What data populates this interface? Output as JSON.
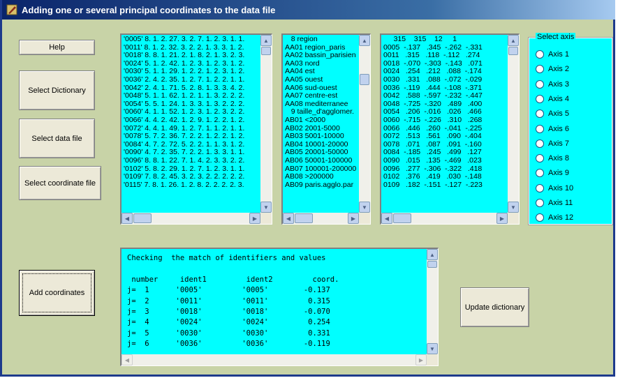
{
  "window": {
    "title": "Adding one or several principal coordinates to the data file"
  },
  "buttons": {
    "help": "Help",
    "select_dictionary": "Select Dictionary",
    "select_data_file": "Select data file",
    "select_coordinate_file": "Select coordinate file",
    "add_coordinates": "Add coordinates",
    "update_dictionary": "Update dictionary"
  },
  "data_list": [
    "'0005' 8. 1. 2. 27. 3. 2. 7. 1. 2. 3. 1. 1.",
    "'0011' 8. 1. 2. 32. 3. 2. 2. 1. 3. 3. 1. 2.",
    "'0018' 8. 8. 1. 21. 2. 1. 8. 2. 1. 3. 2. 3.",
    "'0024' 5. 1. 2. 42. 1. 2. 3. 1. 2. 3. 1. 2.",
    "'0030' 5. 1. 1. 29. 1. 2. 2. 1. 2. 3. 1. 2.",
    "'0036' 2. 4. 2. 35. 1. 2. 7. 1. 2. 2. 1. 1.",
    "'0042' 2. 4. 1. 71. 5. 2. 8. 1. 3. 3. 4. 2.",
    "'0048' 5. 1. 1. 62. 1. 2. 1. 1. 3. 2. 2. 2.",
    "'0054' 5. 5. 1. 24. 1. 3. 3. 1. 3. 2. 2. 2.",
    "'0060' 4. 1. 1. 52. 1. 2. 3. 1. 2. 3. 2. 2.",
    "'0066' 4. 4. 2. 42. 1. 2. 9. 1. 2. 2. 1. 2.",
    "'0072' 4. 4. 1. 49. 1. 2. 7. 1. 1. 2. 1. 1.",
    "'0078' 5. 7. 2. 36. 7. 2. 2. 1. 2. 2. 1. 2.",
    "'0084' 4. 7. 2. 72. 5. 2. 2. 1. 1. 3. 1. 2.",
    "'0090' 4. 7. 2. 35. 7. 2. 2. 1. 3. 3. 1. 1.",
    "'0096' 8. 8. 1. 22. 7. 1. 4. 2. 3. 3. 2. 2.",
    "'0102' 5. 8. 2. 29. 1. 2. 7. 1. 2. 3. 1. 1.",
    "'0109' 7. 8. 2. 45. 3. 2. 3. 2. 2. 2. 2. 2.",
    "'0115' 7. 8. 1. 26. 1. 2. 8. 2. 2. 2. 2. 3."
  ],
  "dictionary_list": [
    "   8 region",
    "AA01 region_paris",
    "AA02 bassin_parisien",
    "AA03 nord",
    "AA04 est",
    "AA05 ouest",
    "AA06 sud-ouest",
    "AA07 centre-est",
    "AA08 mediterranee",
    "   9 taille_d'agglomer.",
    "AB01 <2000",
    "AB02 2001-5000",
    "AB03 5001-10000",
    "AB04 10001-20000",
    "AB05 20001-50000",
    "AB06 50001-100000",
    "AB07 100001-200000",
    "AB08 >200000",
    "AB09 paris.agglo.par"
  ],
  "coordinate_list": [
    "     315    315    12     1",
    "0005  -.137   .345  -.262  -.331",
    "0011   .315   .118  -.112   .274",
    "0018  -.070  -.303  -.143   .071",
    "0024   .254   .212   .088  -.174",
    "0030   .331   .088  -.072  -.029",
    "0036  -.119   .444  -.108  -.371",
    "0042   .588  -.597  -.232  -.447",
    "0048  -.725  -.320   .489   .400",
    "0054   .206  -.016   .026   .466",
    "0060  -.715  -.226   .310   .268",
    "0066   .446   .260  -.041  -.225",
    "0072   .513   .561   .090  -.404",
    "0078   .071   .087   .091  -.160",
    "0084  -.185   .245   .499   .127",
    "0090   .015   .135  -.469   .023",
    "0096   .277  -.306  -.322   .418",
    "0102   .376   .419   .030  -.148",
    "0109   .182  -.151  -.127  -.223"
  ],
  "axis_group": {
    "legend": "Select axis",
    "options": [
      "Axis 1",
      "Axis 2",
      "Axis 3",
      "Axis 4",
      "Axis 5",
      "Axis 6",
      "Axis 7",
      "Axis 8",
      "Axis 9",
      "Axis 10",
      "Axis  11",
      "Axis 12"
    ]
  },
  "console": [
    "Checking  the match of identifiers and values",
    "",
    " number     ident1         ident2         coord.",
    "j=  1      '0005'         '0005'        -0.137",
    "j=  2      '0011'         '0011'         0.315",
    "j=  3      '0018'         '0018'        -0.070",
    "j=  4      '0024'         '0024'         0.254",
    "j=  5      '0030'         '0030'         0.331",
    "j=  6      '0036'         '0036'        -0.119"
  ],
  "colors": {
    "window_bg": "#c8d3a7",
    "list_bg": "#00ffff",
    "titlebar": "#0a246a"
  }
}
